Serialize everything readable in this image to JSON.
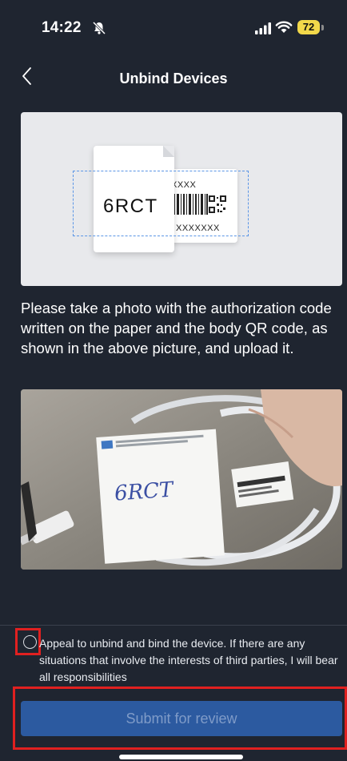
{
  "status_bar": {
    "time": "14:22",
    "battery": "72",
    "icons": [
      "bell-slash-icon",
      "signal-icon",
      "wifi-icon",
      "battery-icon"
    ]
  },
  "nav": {
    "title": "Unbind Devices",
    "back_icon": "chevron-left-icon"
  },
  "illustration": {
    "auth_code": "6RCT",
    "label_line_1": "XXXX",
    "label_line_2": "XXXXXXX"
  },
  "instruction": "Please take a photo with the authorization code written on the paper and the body QR code, as shown in the above picture, and upload it.",
  "photo": {
    "handwritten_code": "6RCT"
  },
  "consent": {
    "text": "Appeal to unbind and bind the device. If there are any situations that involve the interests of third parties, I will bear all responsibilities",
    "checked": false
  },
  "submit": {
    "label": "Submit for review"
  },
  "colors": {
    "background": "#1f2530",
    "button": "#2c5aa0",
    "button_text": "#7f9bc8",
    "highlight_frame": "#e02020"
  }
}
